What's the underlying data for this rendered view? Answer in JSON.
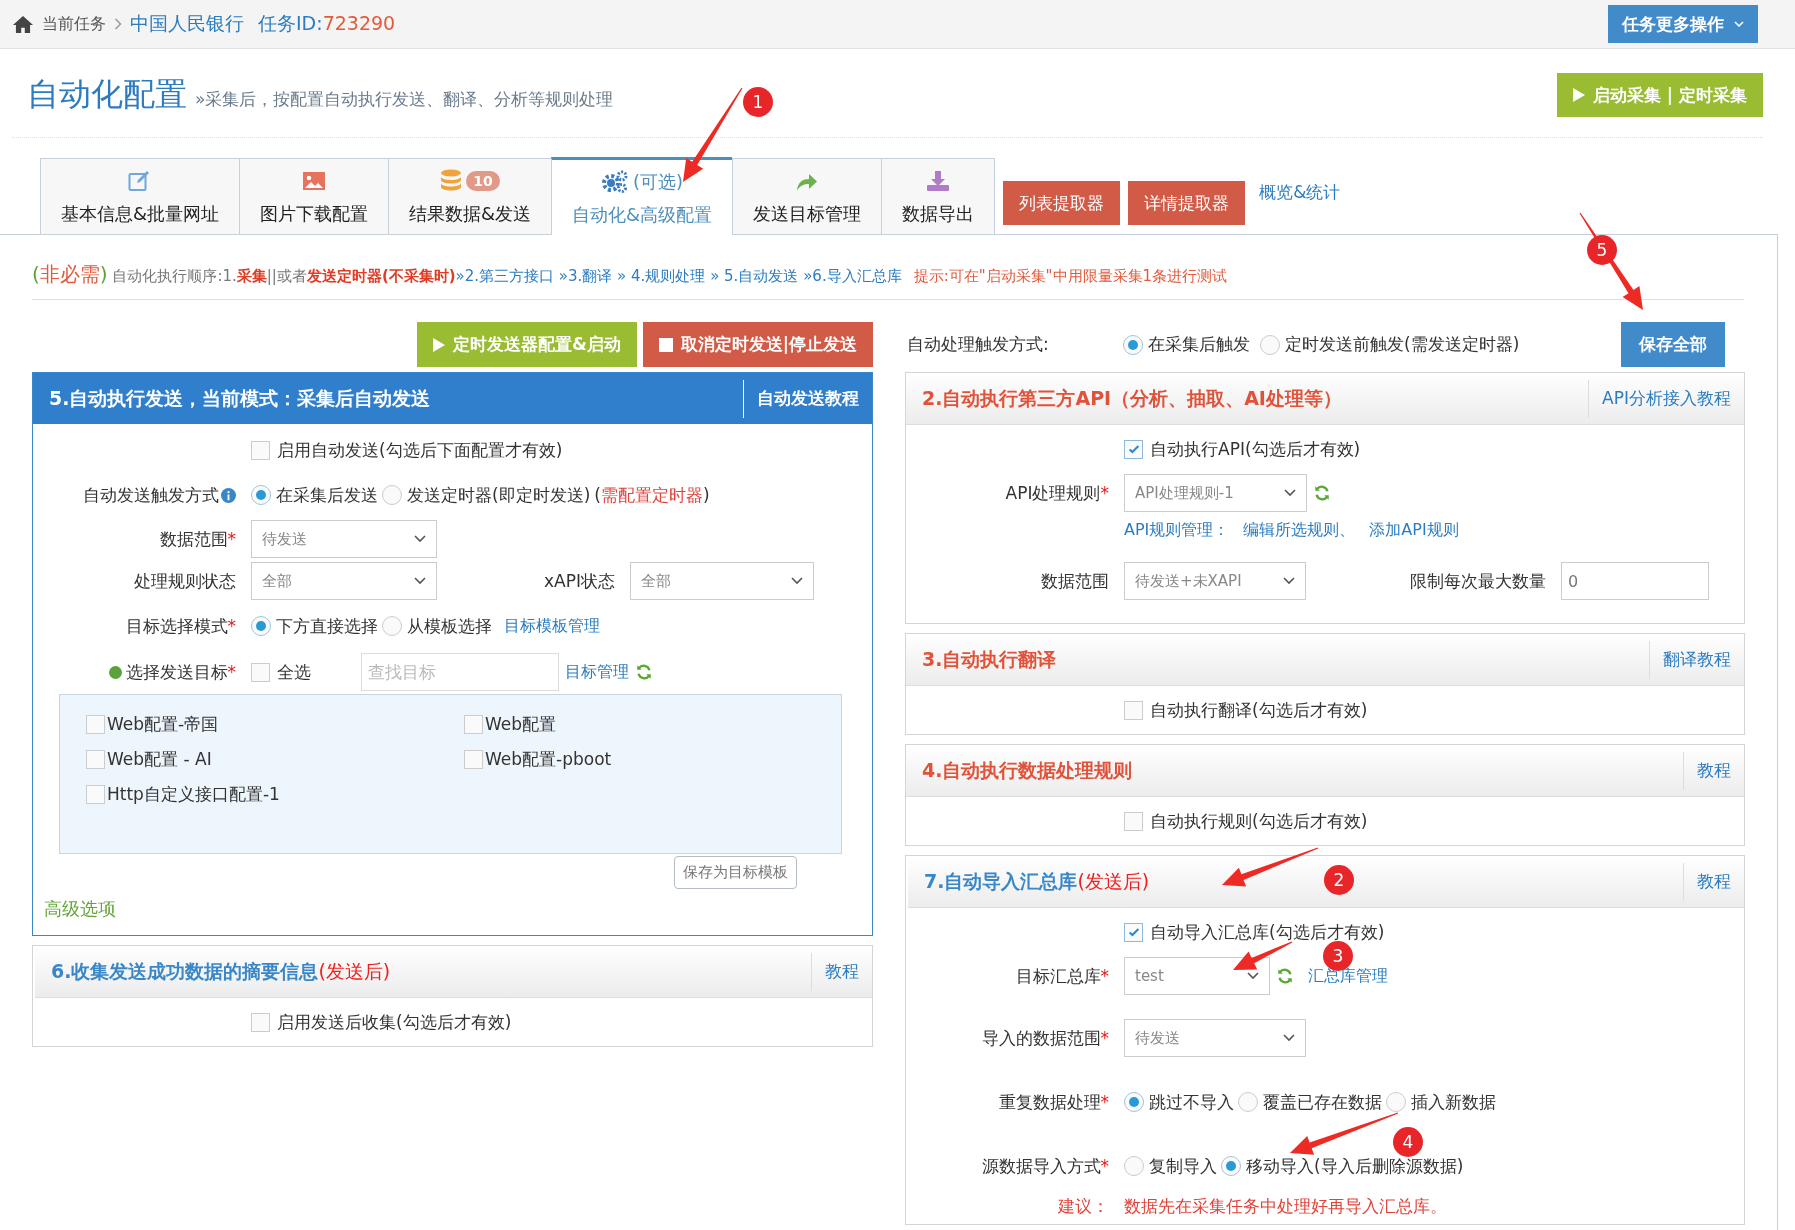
{
  "breadcrumb": {
    "home": "当前任务",
    "task": "中国人民银行",
    "task_id_label": "任务ID:",
    "task_id": "723290"
  },
  "more_button": "任务更多操作",
  "page_title": "自动化配置",
  "subtitle": "»采集后，按配置自动执行发送、翻译、分析等规则处理",
  "start_button": "启动采集 | 定时采集",
  "tabs": [
    {
      "label": "基本信息&批量网址",
      "selected": false
    },
    {
      "label": "图片下载配置",
      "selected": false
    },
    {
      "label": "结果数据&发送",
      "badge": "10",
      "selected": false
    },
    {
      "label": "自动化&高级配置",
      "icon_text": "(可选)",
      "selected": true
    },
    {
      "label": "发送目标管理",
      "selected": false
    },
    {
      "label": "数据导出",
      "selected": false
    }
  ],
  "tool_buttons": [
    "列表提取器",
    "详情提取器"
  ],
  "overview_link": "概览&统计",
  "hint": [
    {
      "text": "(",
      "kind": "paren"
    },
    {
      "text": "非必需",
      "kind": "flag"
    },
    {
      "text": ")",
      "kind": "paren"
    },
    {
      "text": " 自动化执行顺序:1.",
      "kind": "muted"
    },
    {
      "text": "采集",
      "kind": "strong"
    },
    {
      "text": "||或者",
      "kind": "muted"
    },
    {
      "text": "发送定时器(不采集时)",
      "kind": "strong"
    },
    {
      "text": "»2.第三方接口 »3.翻译 » 4.规则处理 » 5.自动发送 »6.导入汇总库",
      "kind": "link"
    },
    {
      "text": "提示:可在\"启动采集\"中用限量采集1条进行测试",
      "kind": "tip"
    }
  ],
  "send_controls": {
    "timer_button": "定时发送器配置&启动",
    "cancel_button": "取消定时发送|停止发送"
  },
  "send_panel": {
    "title": "5.自动执行发送，当前模式：采集后自动发送",
    "help_link": "自动发送教程",
    "enable": {
      "label": "启用自动发送(勾选后下面配置才有效)",
      "checked": false
    },
    "trigger": {
      "label": "自动发送触发方式",
      "options": [
        {
          "label": "在采集后发送",
          "selected": true
        },
        {
          "label": "发送定时器(即定时发送)",
          "selected": false
        }
      ],
      "note_open": "(",
      "note": "需配置定时器",
      "note_close": ")"
    },
    "data_range": {
      "label": "数据范围",
      "mark": "*",
      "value": "待发送"
    },
    "rule_status": {
      "label": "处理规则状态",
      "value": "全部"
    },
    "xapi_status": {
      "label": "xAPI状态",
      "value": "全部"
    },
    "target_mode": {
      "label": "目标选择模式",
      "mark": "*",
      "options": [
        {
          "label": "下方直接选择",
          "selected": true
        },
        {
          "label": "从模板选择",
          "selected": false
        }
      ],
      "link": "目标模板管理"
    },
    "targets": {
      "label": "选择发送目标",
      "mark": "*",
      "select_all": {
        "label": "全选",
        "checked": false
      },
      "search_placeholder": "查找目标",
      "manage_link": "目标管理",
      "items": [
        {
          "label": "Web配置-帝国",
          "checked": false
        },
        {
          "label": "Web配置",
          "checked": false
        },
        {
          "label": "Web配置 - AI",
          "checked": false
        },
        {
          "label": "Web配置-pboot",
          "checked": false
        },
        {
          "label": "Http自定义接口配置-1",
          "checked": false
        }
      ]
    },
    "save_template_button": "保存为目标模板",
    "advanced_link": "高级选项"
  },
  "summary_panel": {
    "title": "6.收集发送成功数据的摘要信息",
    "title_note": "(发送后)",
    "help_link": "教程",
    "enable": {
      "label": "启用发送后收集(勾选后才有效)",
      "checked": false
    }
  },
  "process_trigger": {
    "label": "自动处理触发方式:",
    "options": [
      {
        "label": "在采集后触发",
        "selected": true
      },
      {
        "label": "定时发送前触发(需发送定时器)",
        "selected": false
      }
    ]
  },
  "save_all_button": "保存全部",
  "api_panel": {
    "title": "2.自动执行第三方API（分析、抽取、AI处理等）",
    "help_link": "API分析接入教程",
    "enable": {
      "label": "自动执行API(勾选后才有效)",
      "checked": true
    },
    "rule": {
      "label": "API处理规则",
      "mark": "*",
      "value": "API处理规则-1"
    },
    "links_label": "API规则管理：",
    "links": [
      "编辑所选规则、",
      "添加API规则"
    ],
    "data_range": {
      "label": "数据范围",
      "value": "待发送+未XAPI"
    },
    "limit": {
      "label": "限制每次最大数量",
      "value": "0"
    }
  },
  "translate_panel": {
    "title": "3.自动执行翻译",
    "help_link": "翻译教程",
    "enable": {
      "label": "自动执行翻译(勾选后才有效)",
      "checked": false
    }
  },
  "rules_panel": {
    "title": "4.自动执行数据处理规则",
    "help_link": "教程",
    "enable": {
      "label": "自动执行规则(勾选后才有效)",
      "checked": false
    }
  },
  "import_panel": {
    "title": "7.自动导入汇总库",
    "title_note": "(发送后)",
    "help_link": "教程",
    "enable": {
      "label": "自动导入汇总库(勾选后才有效)",
      "checked": true
    },
    "target": {
      "label": "目标汇总库",
      "mark": "*",
      "value": "test",
      "link": "汇总库管理"
    },
    "data_range": {
      "label": "导入的数据范围",
      "mark": "*",
      "value": "待发送"
    },
    "duplicate": {
      "label": "重复数据处理",
      "mark": "*",
      "options": [
        {
          "label": "跳过不导入",
          "selected": true
        },
        {
          "label": "覆盖已存在数据",
          "selected": false
        },
        {
          "label": "插入新数据",
          "selected": false
        }
      ]
    },
    "source_mode": {
      "label": "源数据导入方式",
      "mark": "*",
      "options": [
        {
          "label": "复制导入",
          "selected": false
        },
        {
          "label": "移动导入(导入后删除源数据)",
          "selected": true
        }
      ]
    },
    "advice": {
      "label": "建议：",
      "text": "数据先在采集任务中处理好再导入汇总库。"
    }
  },
  "annotations": [
    {
      "label": "1"
    },
    {
      "label": "2"
    },
    {
      "label": "3"
    },
    {
      "label": "4"
    },
    {
      "label": "5"
    }
  ]
}
